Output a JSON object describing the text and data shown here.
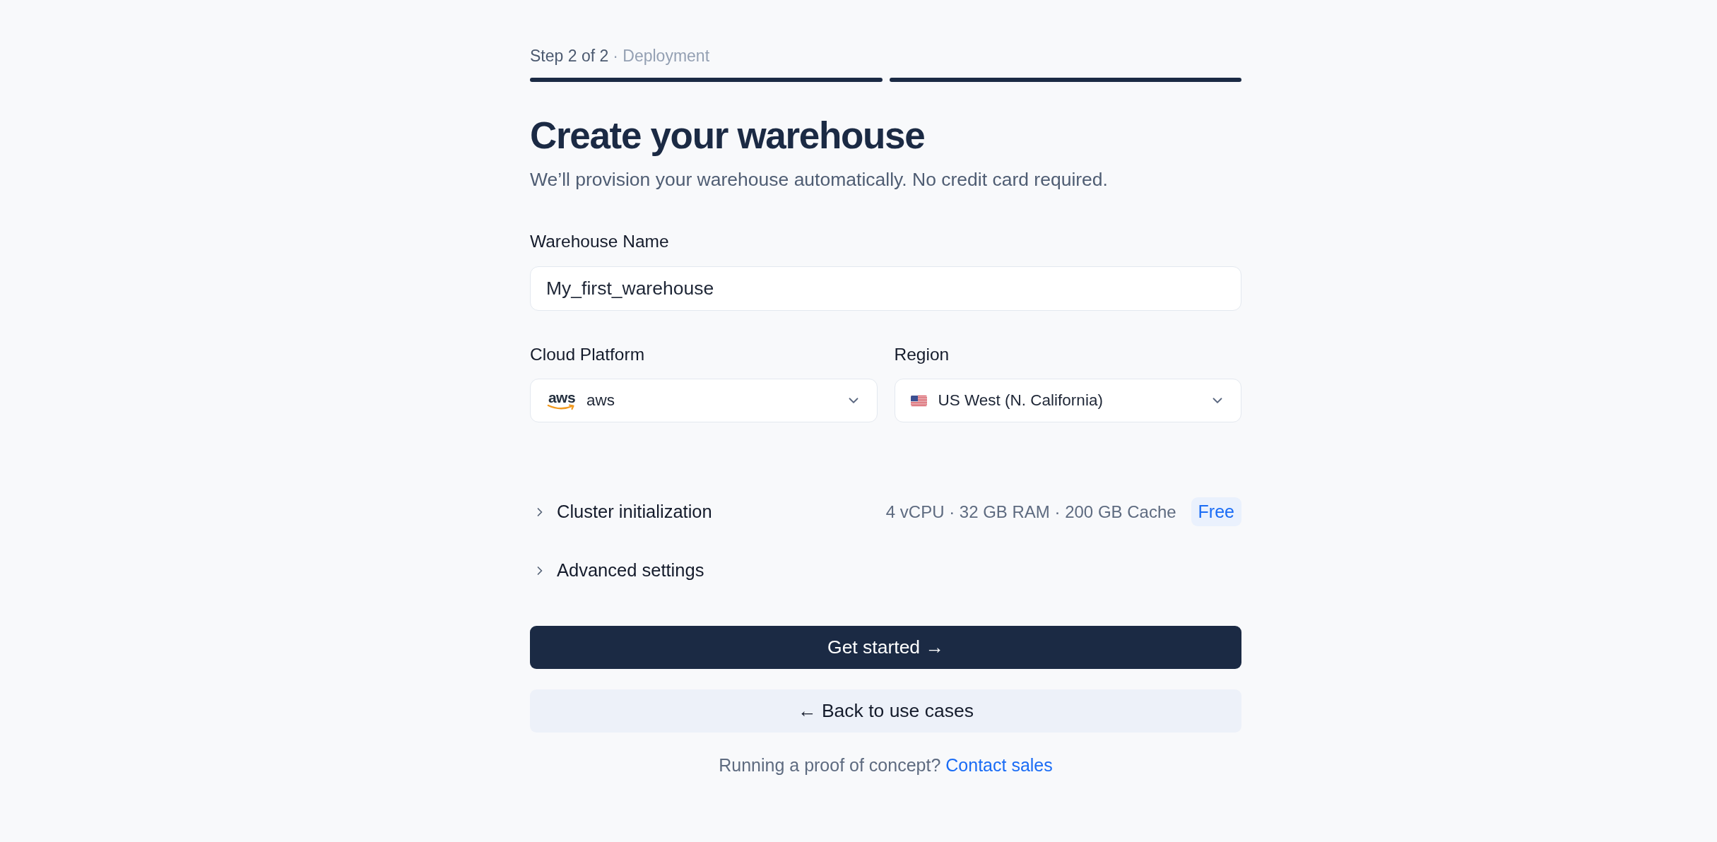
{
  "progress": {
    "step_label": "Step 2 of 2",
    "step_name": "· Deployment",
    "segments": [
      {
        "completed": true
      },
      {
        "completed": true
      }
    ]
  },
  "heading": {
    "title": "Create your warehouse",
    "subtitle": "We’ll provision your warehouse automatically. No credit card required."
  },
  "form": {
    "warehouse_name": {
      "label": "Warehouse Name",
      "value": "My_first_warehouse"
    },
    "cloud_platform": {
      "label": "Cloud Platform",
      "logo": "aws",
      "value": "aws"
    },
    "region": {
      "label": "Region",
      "value": "US West (N. California)"
    }
  },
  "sections": [
    {
      "title": "Cluster initialization",
      "expanded": false,
      "summary": "4 vCPU · 32 GB RAM · 200 GB Cache",
      "badge": "Free"
    },
    {
      "title": "Advanced settings",
      "expanded": false
    }
  ],
  "buttons": [
    {
      "label": "Get started →",
      "kind": "primary"
    },
    {
      "label": "← Back to use cases",
      "kind": "secondary"
    }
  ],
  "footer": {
    "text": "Running a proof of concept?",
    "link": "Contact sales"
  }
}
